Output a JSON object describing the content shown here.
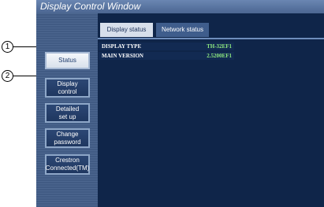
{
  "window": {
    "title": "Display Control Window"
  },
  "sidebar": {
    "items": [
      {
        "label": "Status",
        "active": true
      },
      {
        "label": "Display\ncontrol"
      },
      {
        "label": "Detailed\nset up"
      },
      {
        "label": "Change\npassword"
      },
      {
        "label": "Crestron\nConnected(TM)"
      }
    ]
  },
  "tabs": [
    {
      "label": "Display status",
      "active": true
    },
    {
      "label": "Network status",
      "active": false
    }
  ],
  "status": {
    "rows": [
      {
        "label": "DISPLAY TYPE",
        "value": "TH-32EF1"
      },
      {
        "label": "MAIN VERSION",
        "value": "2.5200EF1"
      }
    ]
  },
  "callouts": [
    "1",
    "2"
  ],
  "colors": {
    "window_bg": "#3d5780",
    "content_bg": "#0f2549",
    "value_text": "#8ee87f",
    "active_tab": "#d7dfeb"
  }
}
